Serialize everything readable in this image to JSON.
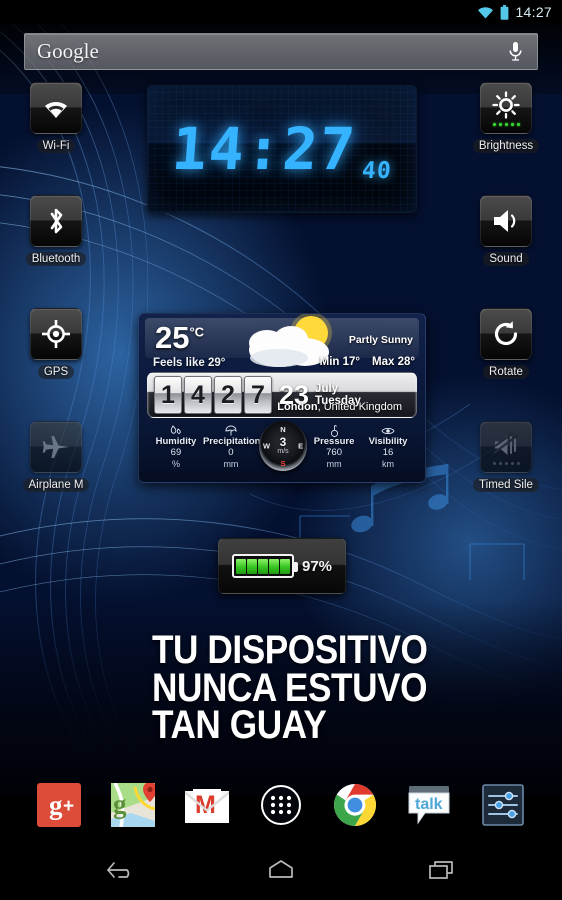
{
  "status_bar": {
    "time": "14:27",
    "wifi_icon": "wifi-icon",
    "battery_icon": "battery-icon"
  },
  "search": {
    "label": "Google",
    "mic_icon": "microphone-icon"
  },
  "left_toggles": [
    {
      "label": "Wi-Fi",
      "icon": "wifi-icon",
      "state": "on"
    },
    {
      "label": "Bluetooth",
      "icon": "bluetooth-icon",
      "state": "on"
    },
    {
      "label": "GPS",
      "icon": "gps-crosshair-icon",
      "state": "on"
    },
    {
      "label": "Airplane M",
      "icon": "airplane-icon",
      "state": "off"
    }
  ],
  "right_toggles": [
    {
      "label": "Brightness",
      "icon": "brightness-sun-icon",
      "state": "on",
      "dots": 5
    },
    {
      "label": "Sound",
      "icon": "speaker-icon",
      "state": "on"
    },
    {
      "label": "Rotate",
      "icon": "rotate-icon",
      "state": "on"
    },
    {
      "label": "Timed Sile",
      "icon": "speaker-muted-icon",
      "state": "off",
      "dots": 5
    }
  ],
  "lcd_clock": {
    "time": "14:27",
    "seconds": "40"
  },
  "weather": {
    "temperature": "25",
    "temperature_unit": "°C",
    "feels_like_label": "Feels like",
    "feels_like_value": "29°",
    "condition": "Partly Sunny",
    "min_label": "Min",
    "min_value": "17°",
    "max_label": "Max",
    "max_value": "28°",
    "icon": "sun-behind-cloud-icon",
    "clock_digits": [
      "1",
      "4",
      "2",
      "7"
    ],
    "date_day": "23",
    "date_month": "July",
    "date_weekday": "Tuesday",
    "city": "London",
    "country": "United Kingdom",
    "metrics": [
      {
        "name": "Humidity",
        "value": "69",
        "unit": "%",
        "icon": "humidity-drop-icon"
      },
      {
        "name": "Precipitation",
        "value": "0",
        "unit": "mm",
        "icon": "umbrella-icon"
      },
      {
        "name": "Pressure",
        "value": "760",
        "unit": "mm",
        "icon": "barometer-icon"
      },
      {
        "name": "Visibility",
        "value": "16",
        "unit": "km",
        "icon": "eye-icon"
      }
    ],
    "wind": {
      "speed": "3",
      "unit": "m/s",
      "north": "N",
      "south": "S",
      "west": "W",
      "east": "E"
    }
  },
  "battery_widget": {
    "percent": "97%",
    "cells": 5
  },
  "promo": {
    "line1": "TU DISPOSITIVO",
    "line2": "NUNCA ESTUVO",
    "line3": "TAN GUAY"
  },
  "dock": [
    {
      "name": "google-plus",
      "icon": "google-plus-icon"
    },
    {
      "name": "maps",
      "icon": "google-maps-icon"
    },
    {
      "name": "gmail",
      "icon": "gmail-icon"
    },
    {
      "name": "app-drawer",
      "icon": "app-drawer-icon"
    },
    {
      "name": "chrome",
      "icon": "chrome-icon"
    },
    {
      "name": "talk",
      "icon": "google-talk-icon",
      "label": "talk"
    },
    {
      "name": "settings",
      "icon": "settings-sliders-icon"
    }
  ],
  "navbar": [
    {
      "name": "back",
      "icon": "back-arrow-icon"
    },
    {
      "name": "home",
      "icon": "home-icon"
    },
    {
      "name": "recents",
      "icon": "recents-icon"
    }
  ],
  "colors": {
    "accent_blue": "#35b3ff",
    "status_cyan": "#54c8e8",
    "battery_green": "#35c421",
    "wallpaper_blue": "#0a2a7a"
  }
}
